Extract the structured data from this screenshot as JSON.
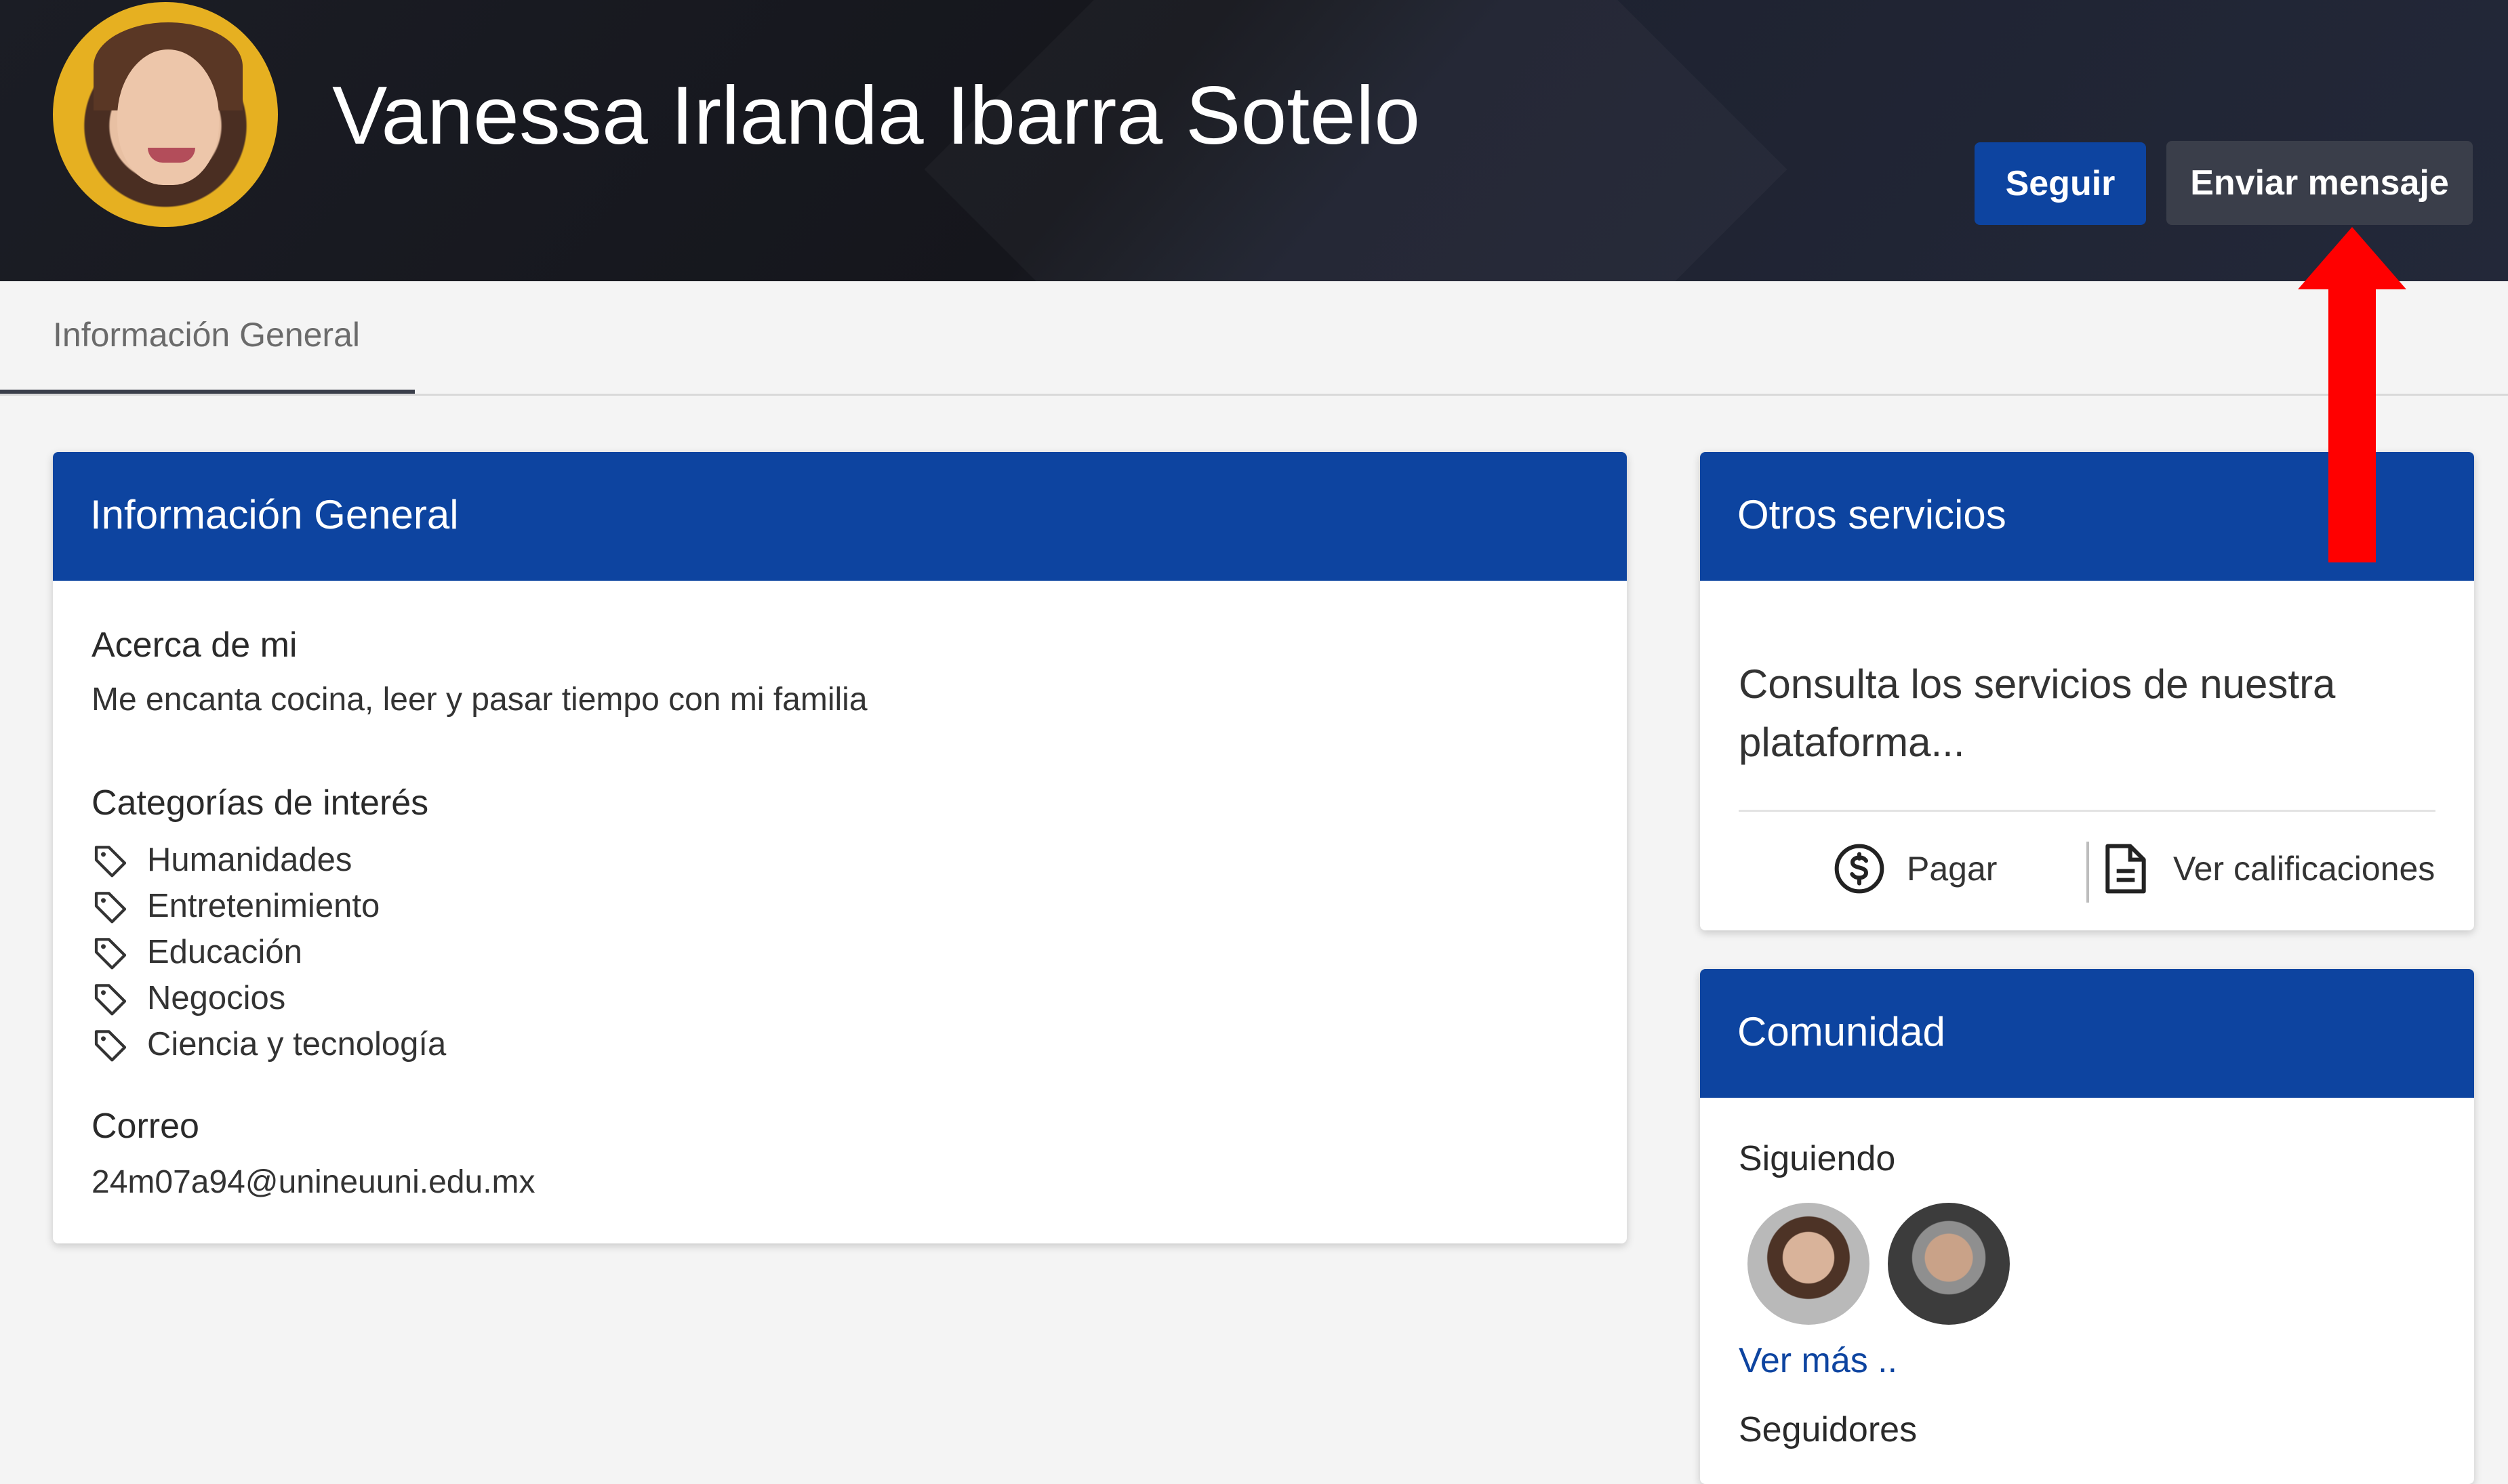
{
  "header": {
    "user_name": "Vanessa Irlanda Ibarra Sotelo",
    "follow_label": "Seguir",
    "message_label": "Enviar mensaje",
    "colors": {
      "background": "#15161c",
      "follow_button": "#0d44a0",
      "message_button": "#3a3e4a"
    }
  },
  "tabs": [
    {
      "label": "Información General",
      "active": true
    }
  ],
  "general_info": {
    "title": "Información General",
    "about_title": "Acerca de mi",
    "about_text": "Me encanta cocina, leer y pasar tiempo con mi familia",
    "categories_title": "Categorías de interés",
    "categories": [
      "Humanidades",
      "Entretenimiento",
      "Educación",
      "Negocios",
      "Ciencia y tecnología"
    ],
    "category_icon": "tag-icon",
    "email_title": "Correo",
    "email": "24m07a94@unineuuni.edu.mx"
  },
  "services": {
    "title": "Otros servicios",
    "text": "Consulta los servicios de nuestra plataforma...",
    "pay_label": "Pagar",
    "pay_icon": "dollar-circle-icon",
    "grades_label": "Ver calificaciones",
    "grades_icon": "document-icon"
  },
  "community": {
    "title": "Comunidad",
    "following_title": "Siguiendo",
    "see_more": "Ver más ..",
    "followers_title": "Seguidores"
  },
  "annotation": {
    "color": "#ff0000",
    "icon": "red-arrow-up-icon"
  },
  "theme": {
    "accent": "#0d44a0",
    "page_background": "#f4f4f4"
  }
}
